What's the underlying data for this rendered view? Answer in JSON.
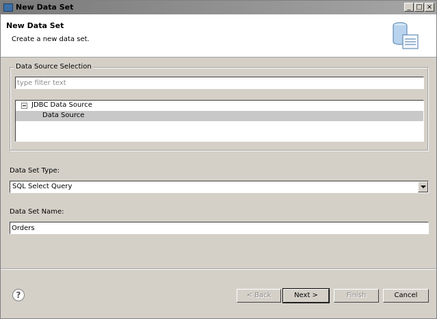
{
  "window": {
    "title": "New Data Set",
    "controls": [
      "_",
      "□",
      "×"
    ]
  },
  "banner": {
    "title": "New Data Set",
    "description": "Create a new data set.",
    "icon": "dataset-wizard-icon"
  },
  "data_source_selection": {
    "legend": "Data Source Selection",
    "filter_placeholder": "type filter text",
    "tree": [
      {
        "label": "JDBC Data Source",
        "expanded": true,
        "level": 0
      },
      {
        "label": "Data Source",
        "selected": true,
        "level": 1
      }
    ]
  },
  "data_set_type": {
    "label": "Data Set Type:",
    "value": "SQL Select Query"
  },
  "data_set_name": {
    "label": "Data Set Name:",
    "value": "Orders"
  },
  "buttons": {
    "back": "< Back",
    "next": "Next >",
    "finish": "Finish",
    "cancel": "Cancel",
    "help": "?"
  }
}
